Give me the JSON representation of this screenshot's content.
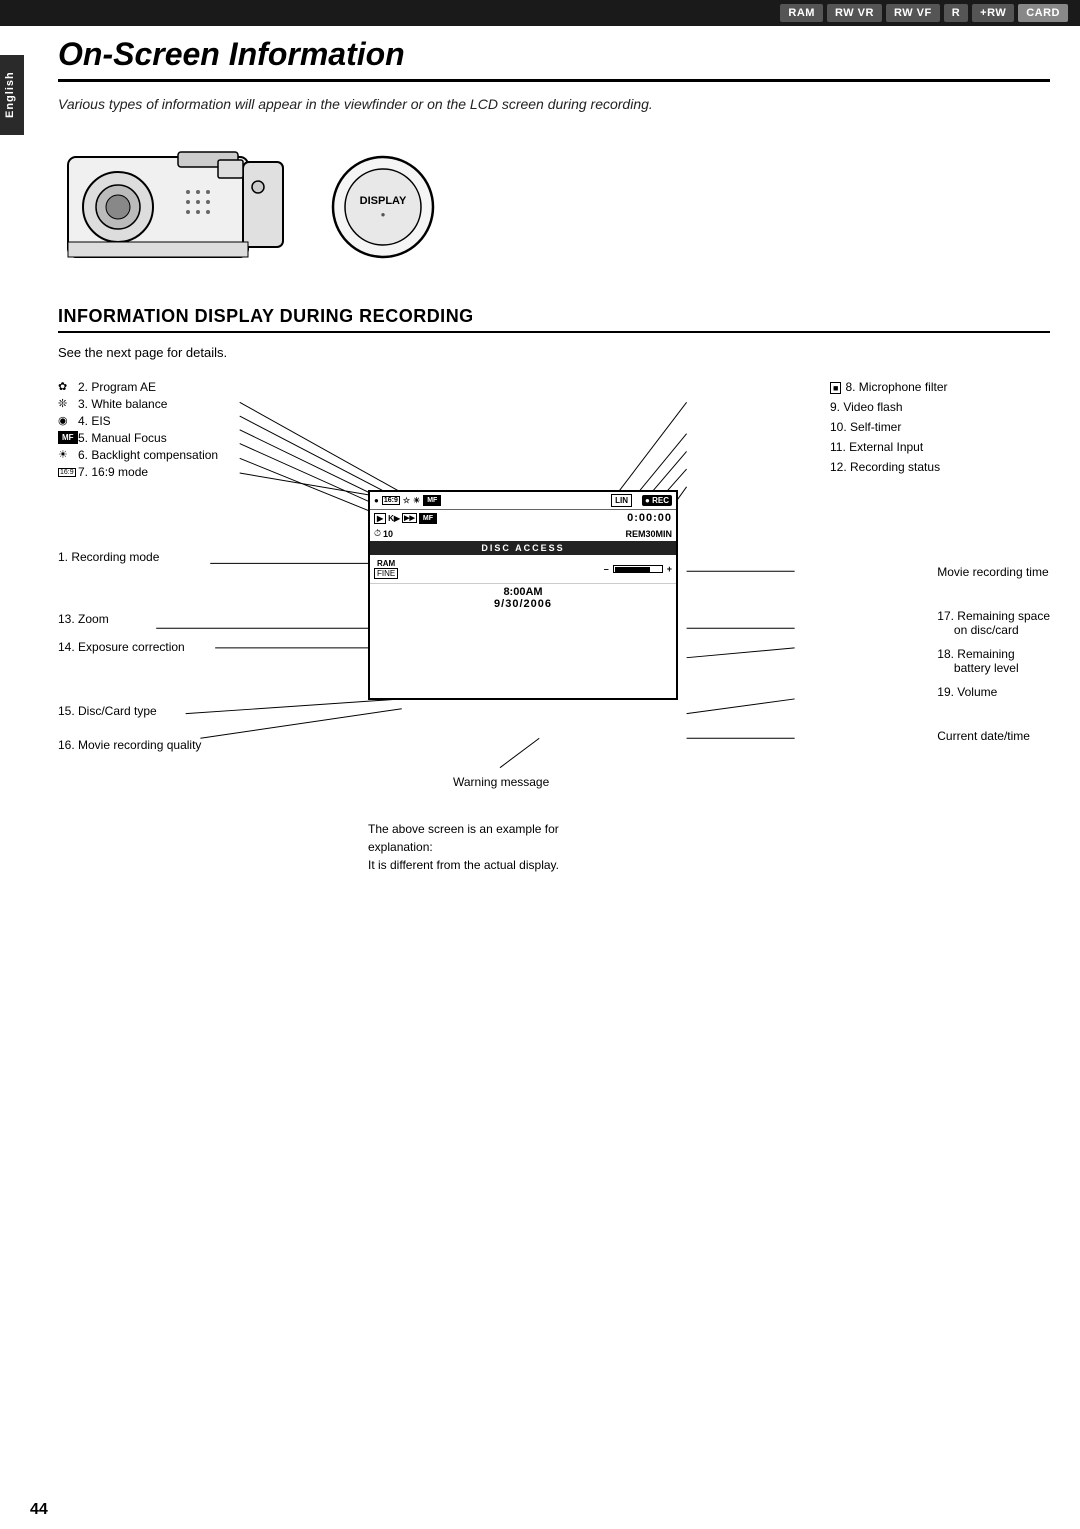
{
  "topbar": {
    "badges": [
      "RAM",
      "RW VR",
      "RW VF",
      "R",
      "+RW",
      "CARD"
    ]
  },
  "sidebar": {
    "label": "English"
  },
  "page": {
    "title": "On-Screen Information",
    "subtitle": "Various types of information will appear in the viewfinder or on the LCD screen during recording.",
    "section_heading": "INFORMATION DISPLAY DURING RECORDING",
    "see_next": "See the next page for details.",
    "page_number": "44"
  },
  "left_labels": [
    {
      "number": "2.",
      "icon": "✿",
      "text": "Program AE"
    },
    {
      "number": "3.",
      "icon": "❄",
      "text": "White balance"
    },
    {
      "number": "4.",
      "icon": "◉",
      "text": "EIS"
    },
    {
      "number": "5.",
      "icon": "MF",
      "text": "Manual Focus",
      "boxed": true
    },
    {
      "number": "6.",
      "icon": "☀",
      "text": "Backlight compensation"
    },
    {
      "number": "7.",
      "icon": "16:9",
      "text": "16:9 mode",
      "boxed": true
    }
  ],
  "right_labels": [
    {
      "number": "8.",
      "text": "Microphone filter"
    },
    {
      "number": "9.",
      "text": "Video flash"
    },
    {
      "number": "10.",
      "text": "Self-timer"
    },
    {
      "number": "11.",
      "text": "External Input"
    },
    {
      "number": "12.",
      "text": "Recording status"
    }
  ],
  "middle_labels_left": [
    {
      "number": "1.",
      "text": "Recording mode"
    },
    {
      "number": "13.",
      "text": "Zoom"
    },
    {
      "number": "14.",
      "text": "Exposure correction"
    },
    {
      "number": "15.",
      "text": "Disc/Card type"
    },
    {
      "number": "16.",
      "text": "Movie recording quality"
    }
  ],
  "middle_labels_right": [
    {
      "text": "Movie recording time"
    },
    {
      "number": "17.",
      "text": "Remaining space on disc/card"
    },
    {
      "number": "18.",
      "text": "Remaining battery level"
    },
    {
      "number": "19.",
      "text": "Volume"
    },
    {
      "text": "Current date/time"
    }
  ],
  "screen": {
    "icons_row": "● 16:9 ☆ ☀ MF",
    "timer": "0:00:00",
    "rem": "REM30MIN",
    "disc_access": "DISC ACCESS",
    "lin": "LIN",
    "rec": "● REC",
    "battery_bar": "—",
    "plus_minus": "– +",
    "time": "8:00AM",
    "date": "9/30/2006",
    "warning_label": "Warning message"
  },
  "note": {
    "line1": "The above screen is an example for",
    "line2": "explanation:",
    "line3": "It is different from the actual display."
  }
}
